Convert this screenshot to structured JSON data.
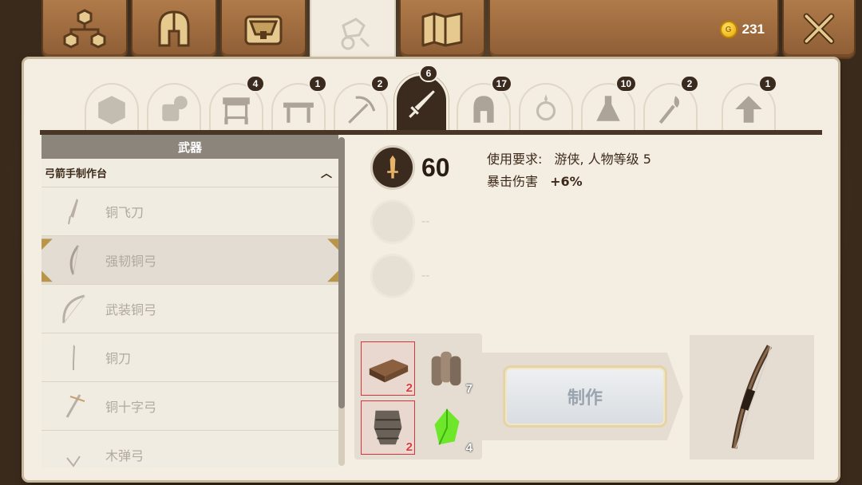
{
  "top": {
    "tabs": [
      {
        "name": "skill-tree",
        "icon": "skill-tree-icon"
      },
      {
        "name": "equipment",
        "icon": "helmet-icon"
      },
      {
        "name": "bag",
        "icon": "bag-icon"
      },
      {
        "name": "crafting",
        "icon": "crafting-icon"
      },
      {
        "name": "map",
        "icon": "map-icon"
      }
    ],
    "coins": "231",
    "close_icon": "close-icon"
  },
  "subtabs": [
    {
      "icon": "block-icon",
      "badge": ""
    },
    {
      "icon": "materials-icon",
      "badge": ""
    },
    {
      "icon": "furnace-icon",
      "badge": "4"
    },
    {
      "icon": "table-icon",
      "badge": "1"
    },
    {
      "icon": "pickaxe-icon",
      "badge": "2"
    },
    {
      "icon": "sword-icon",
      "badge": "6"
    },
    {
      "icon": "helmet-icon",
      "badge": "17"
    },
    {
      "icon": "ring-icon",
      "badge": ""
    },
    {
      "icon": "potion-icon",
      "badge": "10"
    },
    {
      "icon": "torch-icon",
      "badge": "2"
    },
    {
      "icon": "upgrade-arrow-icon",
      "badge": "1"
    }
  ],
  "list": {
    "header": "武器",
    "station": "弓箭手制作台",
    "items": [
      {
        "label": "铜飞刀"
      },
      {
        "label": "强韧铜弓"
      },
      {
        "label": "武装铜弓"
      },
      {
        "label": "铜刀"
      },
      {
        "label": "铜十字弓"
      },
      {
        "label": "木弹弓"
      }
    ]
  },
  "detail": {
    "attack_value": "60",
    "empty_dash_1": "--",
    "empty_dash_2": "--",
    "requirement_label": "使用要求:",
    "requirement_value": "游侠, 人物等级 5",
    "crit_label": "暴击伤害",
    "crit_value": "+6%"
  },
  "craft": {
    "materials": [
      {
        "name": "copper-ingot",
        "count": "2",
        "missing": true
      },
      {
        "name": "wood-logs",
        "count": "7",
        "missing": false
      },
      {
        "name": "leather-scale",
        "count": "2",
        "missing": true
      },
      {
        "name": "green-gem",
        "count": "4",
        "missing": false
      }
    ],
    "button_label": "制作"
  },
  "colors": {
    "panel": "#f3ede2",
    "tab_wood": "#a36f42",
    "dark": "#3b2a1e",
    "missing_red": "#d4363c"
  }
}
